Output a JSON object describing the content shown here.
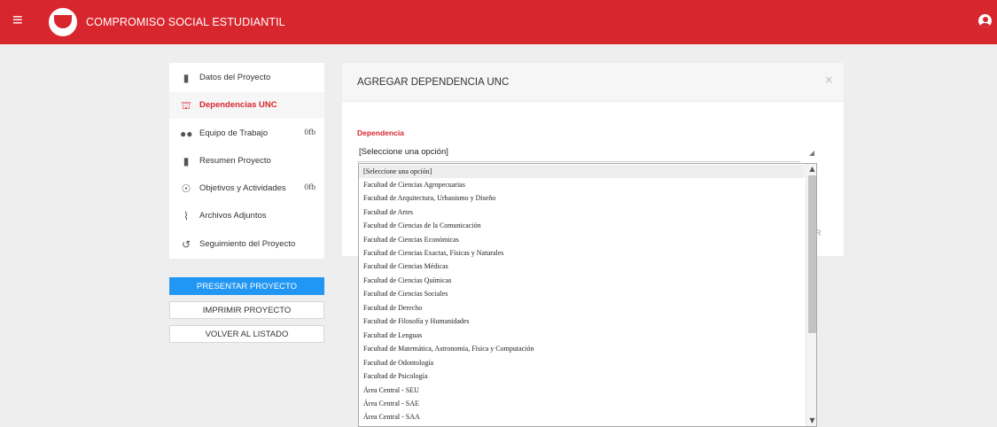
{
  "header": {
    "menu_icon": "hamburger-icon",
    "title": "COMPROMISO SOCIAL ESTUDIANTIL",
    "user_icon": "user-circle-icon",
    "color": "#d8262e"
  },
  "sidebar": {
    "items": [
      {
        "label": "Datos del Proyecto",
        "icon": "document-icon",
        "count": ""
      },
      {
        "label": "Dependencias UNC",
        "icon": "institution-icon",
        "count": "",
        "active": true
      },
      {
        "label": "Equipo de Trabajo",
        "icon": "people-icon",
        "count": "0fb"
      },
      {
        "label": "Resumen Proyecto",
        "icon": "clipboard-icon",
        "count": ""
      },
      {
        "label": "Objetivos y Actividades",
        "icon": "target-icon",
        "count": "0fb"
      },
      {
        "label": "Archivos Adjuntos",
        "icon": "paperclip-icon",
        "count": ""
      },
      {
        "label": "Seguimiento del Proyecto",
        "icon": "history-icon",
        "count": ""
      }
    ]
  },
  "actions": {
    "present": "PRESENTAR PROYECTO",
    "print": "IMPRIMIR PROYECTO",
    "back": "VOLVER AL LISTADO",
    "primary_color": "#2196f3"
  },
  "modal": {
    "title": "AGREGAR DEPENDENCIA UNC",
    "close_icon": "close-icon",
    "field_label": "Dependencia",
    "select_value": "[Seleccione una opción]",
    "footer_fragment": "R"
  },
  "dropdown": {
    "options": [
      "[Seleccione una opción]",
      "Facultad de Ciencias Agropecuarias",
      "Facultad de Arquitectura, Urbanismo y Diseño",
      "Facultad de Artes",
      "Facultad de Ciencias de la Comunicación",
      "Facultad de Ciencias Económicas",
      "Facultad de Ciencias Exactas, Físicas y Naturales",
      "Facultad de Ciencias Médicas",
      "Facultad de Ciencias Químicas",
      "Facultad de Ciencias Sociales",
      "Facultad de Derecho",
      "Facultad de Filosofía y Humanidades",
      "Facultad de Lenguas",
      "Facultad de Matemática, Astronomía, Física y Computación",
      "Facultad de Odontología",
      "Facultad de Psicología",
      "Área Central - SEU",
      "Área Central - SAE",
      "Área Central - SAA"
    ],
    "selected_index": 0
  }
}
